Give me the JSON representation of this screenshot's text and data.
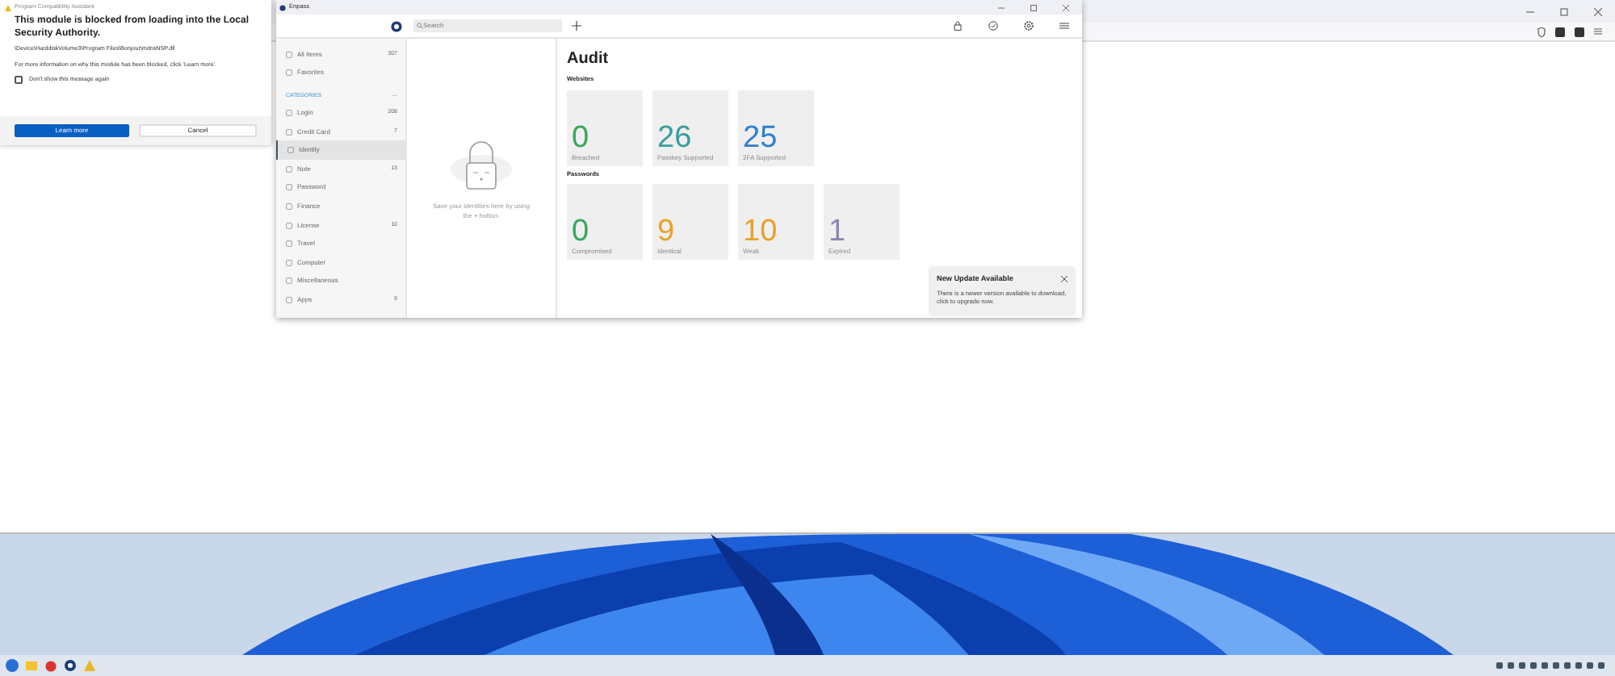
{
  "dialog": {
    "title": "Program Compatibility Assistant",
    "heading": "This module is blocked from loading into the Local Security Authority.",
    "path": "\\Device\\HarddiskVolume3\\Program Files\\Bonjour\\mdnsNSP.dll",
    "info": "For more information on why this module has been blocked, click 'Learn more'.",
    "checkbox": {
      "label": "Don't show this message again",
      "checked": false
    },
    "buttons": [
      "Learn more",
      "Cancel"
    ]
  },
  "app": {
    "title": "Enpass",
    "search": {
      "placeholder": "Search"
    },
    "sidebar": {
      "top": [
        {
          "label": "All Items",
          "count": "307",
          "selected": false
        },
        {
          "label": "Favorites",
          "selected": false
        }
      ],
      "categories_header": "CATEGORIES",
      "categories_mark": "—",
      "categories": [
        {
          "label": "Login",
          "count": "208",
          "selected": false
        },
        {
          "label": "Credit Card",
          "count": "7",
          "selected": false
        },
        {
          "label": "Identity",
          "selected": true
        },
        {
          "label": "Note",
          "count": "13",
          "selected": false
        },
        {
          "label": "Password",
          "selected": false
        },
        {
          "label": "Finance",
          "selected": false
        },
        {
          "label": "License",
          "count": "10",
          "selected": false
        },
        {
          "label": "Travel",
          "selected": false
        },
        {
          "label": "Computer",
          "selected": false
        },
        {
          "label": "Miscellaneous",
          "selected": false
        },
        {
          "label": "Apps",
          "count": "9",
          "selected": false
        }
      ]
    },
    "empty_message": "Save your identities here by using the + button.",
    "audit": {
      "title": "Audit",
      "sections": [
        {
          "title": "Websites",
          "tiles": [
            {
              "value": "0",
              "label": "Breached",
              "color": "#3aa65a"
            },
            {
              "value": "26",
              "label": "Passkey Supported",
              "color": "#3a9e9a"
            },
            {
              "value": "25",
              "label": "2FA Supported",
              "color": "#2f7fd0"
            }
          ]
        },
        {
          "title": "Passwords",
          "tiles": [
            {
              "value": "0",
              "label": "Compromised",
              "color": "#3aa65a"
            },
            {
              "value": "9",
              "label": "Identical",
              "color": "#e8a12a"
            },
            {
              "value": "10",
              "label": "Weak",
              "color": "#e8a12a"
            },
            {
              "value": "1",
              "label": "Expired",
              "color": "#8a86b0"
            }
          ]
        }
      ]
    },
    "toast": {
      "title": "New Update Available",
      "message": "There is a newer version available to download, click to upgrade now."
    }
  }
}
